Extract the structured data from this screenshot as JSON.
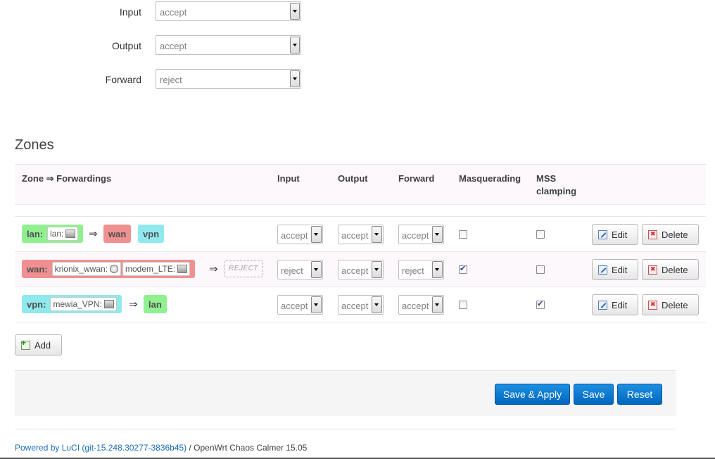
{
  "defaults": {
    "input": {
      "label": "Input",
      "value": "accept"
    },
    "output": {
      "label": "Output",
      "value": "accept"
    },
    "forward": {
      "label": "Forward",
      "value": "reject"
    }
  },
  "zones_title": "Zones",
  "table": {
    "headers": {
      "zone": "Zone ⇒ Forwardings",
      "input": "Input",
      "output": "Output",
      "forward": "Forward",
      "masq": "Masquerading",
      "mss": "MSS clamping"
    },
    "arrow": "⇒",
    "rows": [
      {
        "zone": "lan:",
        "networks": [
          "lan:"
        ],
        "forwards": [
          "wan",
          "vpn"
        ],
        "input": "accept",
        "output": "accept",
        "forward": "accept",
        "masquerading": false,
        "mss_clamping": false
      },
      {
        "zone": "wan:",
        "networks": [
          "krionix_wwan:",
          "modem_LTE:"
        ],
        "forwards_reject": "REJECT",
        "input": "reject",
        "output": "accept",
        "forward": "reject",
        "masquerading": true,
        "mss_clamping": false
      },
      {
        "zone": "vpn:",
        "networks": [
          "mewia_VPN:"
        ],
        "forwards": [
          "lan"
        ],
        "input": "accept",
        "output": "accept",
        "forward": "accept",
        "masquerading": false,
        "mss_clamping": true
      }
    ],
    "edit_label": "Edit",
    "delete_label": "Delete"
  },
  "add_label": "Add",
  "actions": {
    "save_apply": "Save & Apply",
    "save": "Save",
    "reset": "Reset"
  },
  "footer": {
    "link": "Powered by LuCI (git-15.248.30277-3836b45)",
    "text": " / OpenWrt Chaos Calmer 15.05"
  },
  "colors": {
    "lan": "#90f090",
    "wan": "#f09090",
    "vpn": "#90e9ee",
    "primary": "#0069d6"
  }
}
